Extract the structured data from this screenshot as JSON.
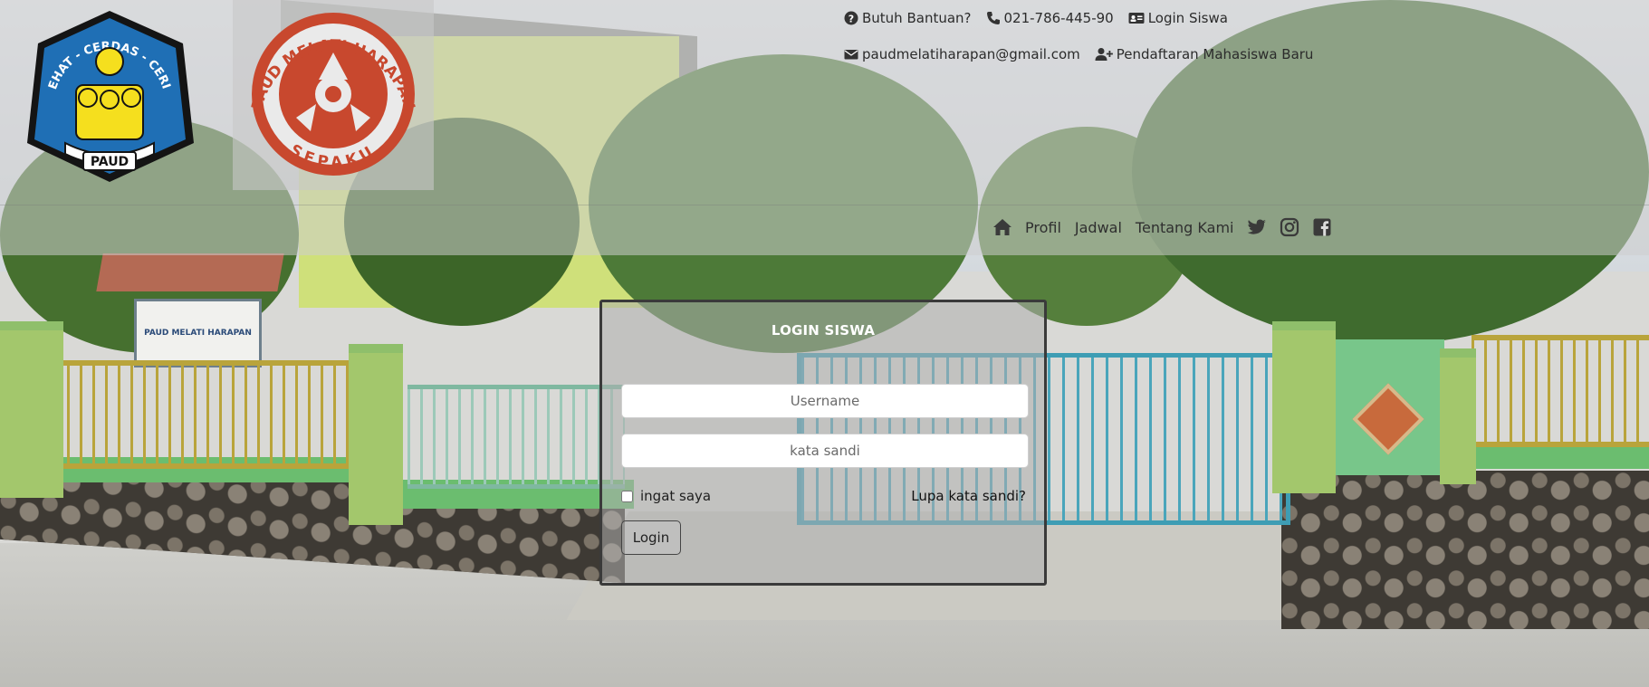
{
  "header": {
    "logos": [
      {
        "name": "tut-wuri-paud-logo",
        "text_top": "SEHAT - CERDAS - CERIA",
        "text_bottom": "PAUD"
      },
      {
        "name": "paud-melati-harapan-logo",
        "text_top": "PAUD MELATI HARAPAN",
        "text_bottom": "SEPAKU"
      }
    ],
    "top_links_row1": [
      {
        "icon": "question-circle-icon",
        "label": "Butuh Bantuan?"
      },
      {
        "icon": "phone-icon",
        "label": "021-786-445-90"
      },
      {
        "icon": "id-card-icon",
        "label": "Login Siswa"
      }
    ],
    "top_links_row2": [
      {
        "icon": "envelope-icon",
        "label": "paudmelatiharapan@gmail.com"
      },
      {
        "icon": "user-plus-icon",
        "label": "Pendaftaran Mahasiswa Baru"
      }
    ],
    "nav": {
      "home_icon": "home-icon",
      "links": [
        "Profil",
        "Jadwal",
        "Tentang Kami"
      ],
      "social_icons": [
        "twitter-icon",
        "instagram-icon",
        "facebook-icon"
      ]
    }
  },
  "login": {
    "title": "LOGIN SISWA",
    "username_placeholder": "Username",
    "password_placeholder": "kata sandi",
    "remember_label": "ingat saya",
    "forgot_label": "Lupa kata sandi?",
    "submit_label": "Login"
  },
  "background": {
    "sign_line1": "PAUD MELATI HARAPAN"
  },
  "colors": {
    "logo_blue": "#1f6fb5",
    "logo_yellow": "#f5df1e",
    "logo_red": "#c8482e",
    "card_title": "#ffffff",
    "card_border": "#3a3a3a"
  }
}
